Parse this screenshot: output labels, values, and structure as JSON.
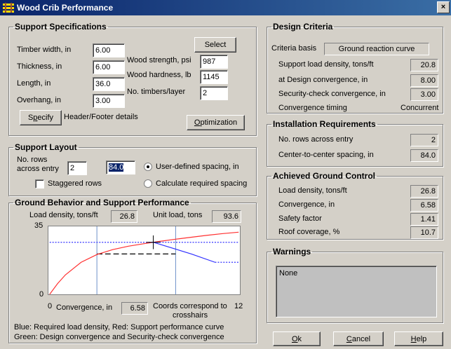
{
  "window": {
    "title": "Wood Crib Performance",
    "close_glyph": "×"
  },
  "support_specs": {
    "legend": "Support Specifications",
    "timber_width_label": "Timber width, in",
    "timber_width": "6.00",
    "thickness_label": "Thickness, in",
    "thickness": "6.00",
    "length_label": "Length, in",
    "length": "36.0",
    "overhang_label": "Overhang, in",
    "overhang": "3.00",
    "select_button": "Select",
    "strength_label": "Wood strength, psi",
    "strength": "987",
    "hardness_label": "Wood hardness, lb",
    "hardness": "1145",
    "timbers_label": "No. timbers/layer",
    "timbers": "2",
    "specify_button_first": "S",
    "specify_button_mn": "p",
    "specify_button_rest": "ecify",
    "header_footer_label": "Header/Footer details",
    "optimization_mn": "O",
    "optimization_rest": "ptimization"
  },
  "layout": {
    "legend": "Support Layout",
    "rows_label_1": "No. rows",
    "rows_label_2": "across entry",
    "rows": "2",
    "spacing": "84.0",
    "radio_user": "User-defined spacing, in",
    "radio_calc": "Calculate required spacing",
    "staggered_label": "Staggered rows",
    "radio_user_selected": true,
    "staggered_checked": false
  },
  "ground": {
    "legend": "Ground Behavior and Support Performance",
    "load_density_label": "Load density, tons/ft",
    "load_density": "26.8",
    "unit_load_label": "Unit load, tons",
    "unit_load": "93.6",
    "convergence_label": "Convergence, in",
    "convergence": "6.58",
    "coords_label_1": "Coords correspond to",
    "coords_label_2": "crosshairs",
    "note_1": "Blue: Required load density, Red: Support performance curve",
    "note_2": "Green: Design convergence and Security-check convergence"
  },
  "chart_data": {
    "type": "line",
    "xlabel": "Convergence, in",
    "ylabel": "",
    "xlim": [
      0,
      12
    ],
    "ylim": [
      0,
      35
    ],
    "x_ticks": [
      "0",
      "12"
    ],
    "y_ticks": [
      "35",
      "0"
    ],
    "series": [
      {
        "color": "#ff3030",
        "x": [
          0,
          0.5,
          1,
          2,
          3,
          4,
          5,
          6,
          6.58,
          7,
          8,
          9,
          10,
          11,
          12
        ],
        "y": [
          0,
          5.5,
          10,
          16.5,
          20.5,
          23,
          24.8,
          26.1,
          26.8,
          27.3,
          28.4,
          29.4,
          30.4,
          31.3,
          32
        ]
      },
      {
        "color": "#3030ff",
        "x": [
          0,
          6.58,
          9,
          10.5,
          12
        ],
        "y": [
          26.8,
          26.8,
          20.8,
          16.5,
          16.5
        ]
      },
      {
        "color": "#3030ff",
        "x": [
          0,
          12
        ],
        "y": [
          26.8,
          26.8
        ]
      }
    ],
    "vlines": [
      3.0,
      8.0
    ],
    "design_load": 20.8,
    "design_convergence": 8.0,
    "crosshair": [
      6.58,
      26.8
    ]
  },
  "criteria": {
    "legend": "Design Criteria",
    "basis_label": "Criteria basis",
    "basis_value": "Ground reaction curve",
    "load_label": "Support load density, tons/ft",
    "load": "20.8",
    "design_conv_label": "at Design convergence, in",
    "design_conv": "8.00",
    "security_label": "Security-check convergence, in",
    "security": "3.00",
    "timing_label": "Convergence timing",
    "timing": "Concurrent"
  },
  "install": {
    "legend": "Installation Requirements",
    "rows_label": "No. rows across entry",
    "rows": "2",
    "spacing_label": "Center-to-center spacing, in",
    "spacing": "84.0"
  },
  "achieved": {
    "legend": "Achieved Ground Control",
    "load_label": "Load density, tons/ft",
    "load": "26.8",
    "conv_label": "Convergence, in",
    "conv": "6.58",
    "safety_label": "Safety factor",
    "safety": "1.41",
    "roof_label": "Roof coverage, %",
    "roof": "10.7"
  },
  "warnings": {
    "legend": "Warnings",
    "text": "None"
  },
  "buttons": {
    "ok_mn": "O",
    "ok_rest": "k",
    "cancel_mn": "C",
    "cancel_rest": "ancel",
    "help_mn": "H",
    "help_rest": "elp"
  }
}
